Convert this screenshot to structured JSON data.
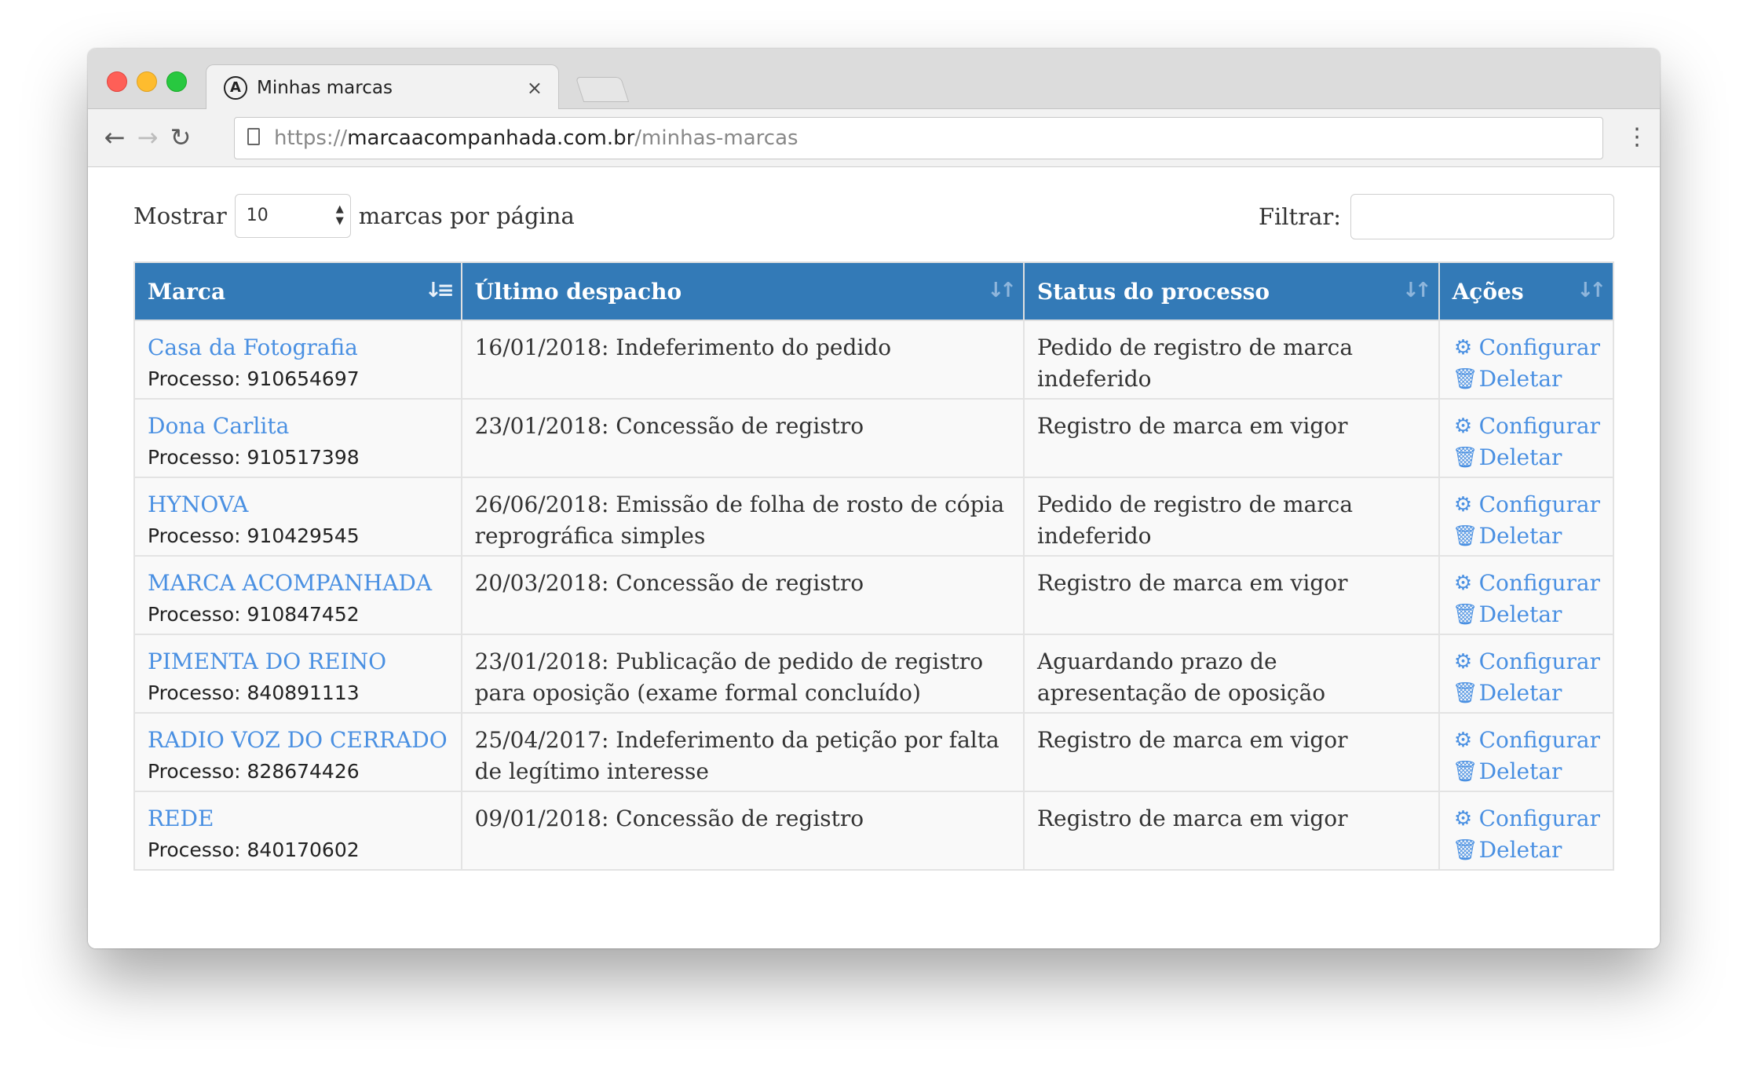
{
  "browser": {
    "tab_title": "Minhas marcas",
    "tab_favicon": "A",
    "tab_close": "×",
    "url_scheme": "https://",
    "url_host": "marcaacompanhada.com.br",
    "url_path": "/minhas-marcas"
  },
  "controls": {
    "show_label": "Mostrar",
    "page_size": "10",
    "per_page_label": "marcas por página",
    "filter_label": "Filtrar:",
    "filter_value": ""
  },
  "table": {
    "headers": [
      "Marca",
      "Último despacho",
      "Status do processo",
      "Ações"
    ],
    "rows": [
      {
        "marca": "Casa da Fotografia",
        "processo": "Processo: 910654697",
        "despacho": "16/01/2018: Indeferimento do pedido",
        "status": "Pedido de registro de marca indeferido"
      },
      {
        "marca": "Dona Carlita",
        "processo": "Processo: 910517398",
        "despacho": "23/01/2018: Concessão de registro",
        "status": "Registro de marca em vigor"
      },
      {
        "marca": "HYNOVA",
        "processo": "Processo: 910429545",
        "despacho": "26/06/2018: Emissão de folha de rosto de cópia reprográfica simples",
        "status": "Pedido de registro de marca indeferido"
      },
      {
        "marca": "MARCA ACOMPANHADA",
        "processo": "Processo: 910847452",
        "despacho": "20/03/2018: Concessão de registro",
        "status": "Registro de marca em vigor"
      },
      {
        "marca": "PIMENTA DO REINO",
        "processo": "Processo: 840891113",
        "despacho": "23/01/2018: Publicação de pedido de registro para oposição (exame formal concluído)",
        "status": "Aguardando prazo de apresentação de oposição"
      },
      {
        "marca": "RADIO VOZ DO CERRADO",
        "processo": "Processo: 828674426",
        "despacho": "25/04/2017: Indeferimento da petição por falta de legítimo interesse",
        "status": "Registro de marca em vigor"
      },
      {
        "marca": "REDE",
        "processo": "Processo: 840170602",
        "despacho": "09/01/2018: Concessão de registro",
        "status": "Registro de marca em vigor"
      }
    ],
    "actions": {
      "configure": "Configurar",
      "delete": "Deletar"
    }
  },
  "icons": {
    "configure": "gear-icon",
    "delete": "trash-icon",
    "sort": "sort-icon"
  },
  "colors": {
    "header_bg": "#337ab7",
    "link": "#4a90e2"
  }
}
